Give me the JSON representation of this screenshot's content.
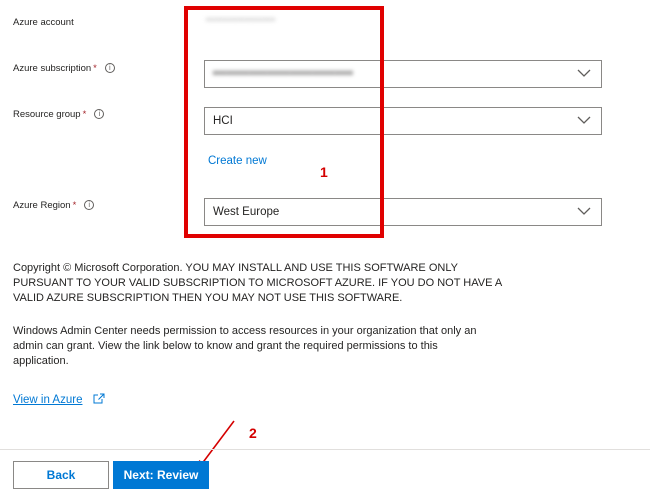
{
  "form": {
    "account": {
      "label": "Azure account",
      "value": "••••••••••••••••"
    },
    "subscription": {
      "label": "Azure subscription",
      "required": "*",
      "value": "•••••••••••••••••••••••••••••••"
    },
    "resource_group": {
      "label": "Resource group",
      "required": "*",
      "value": "HCI",
      "create_new": "Create new"
    },
    "region": {
      "label": "Azure Region",
      "required": "*",
      "value": "West Europe"
    }
  },
  "copyright": "Copyright © Microsoft Corporation. YOU MAY INSTALL AND USE THIS SOFTWARE ONLY PURSUANT TO YOUR VALID SUBSCRIPTION TO MICROSOFT AZURE. IF YOU DO NOT HAVE A VALID AZURE SUBSCRIPTION THEN YOU MAY NOT USE THIS SOFTWARE.",
  "permission_note": "Windows Admin Center needs permission to access resources in your organization that only an admin can grant. View the link below to know and grant the required permissions to this application.",
  "view_in_azure": "View in Azure",
  "buttons": {
    "back": "Back",
    "next": "Next: Review"
  },
  "annotations": {
    "box_number": "1",
    "arrow_number": "2"
  },
  "colors": {
    "accent": "#0078d4",
    "annotation": "#e00000"
  }
}
